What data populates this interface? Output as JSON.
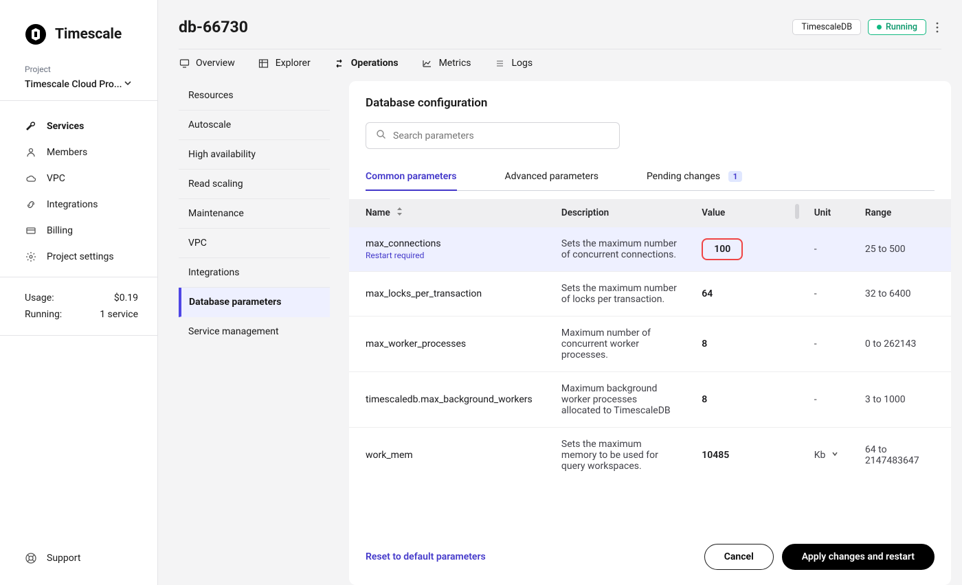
{
  "logo_text": "Timescale",
  "project_label": "Project",
  "project_name": "Timescale Cloud Pro...",
  "nav": {
    "services": "Services",
    "members": "Members",
    "vpc": "VPC",
    "integrations": "Integrations",
    "billing": "Billing",
    "project_settings": "Project settings"
  },
  "usage": {
    "usage_label": "Usage:",
    "usage_value": "$0.19",
    "running_label": "Running:",
    "running_value": "1 service"
  },
  "support_label": "Support",
  "header": {
    "title": "db-66730",
    "badge_db": "TimescaleDB",
    "badge_status": "Running"
  },
  "top_tabs": {
    "overview": "Overview",
    "explorer": "Explorer",
    "operations": "Operations",
    "metrics": "Metrics",
    "logs": "Logs"
  },
  "subnav": {
    "resources": "Resources",
    "autoscale": "Autoscale",
    "ha": "High availability",
    "read_scaling": "Read scaling",
    "maintenance": "Maintenance",
    "vpc": "VPC",
    "integrations": "Integrations",
    "db_params": "Database parameters",
    "service_mgmt": "Service management"
  },
  "panel": {
    "title": "Database configuration",
    "search_placeholder": "Search parameters"
  },
  "param_tabs": {
    "common": "Common parameters",
    "advanced": "Advanced parameters",
    "pending": "Pending changes",
    "pending_count": "1"
  },
  "table": {
    "headers": {
      "name": "Name",
      "description": "Description",
      "value": "Value",
      "unit": "Unit",
      "range": "Range"
    },
    "rows": [
      {
        "name": "max_connections",
        "restart": "Restart required",
        "desc": "Sets the maximum number of concurrent connections.",
        "value": "100",
        "unit": "-",
        "range": "25 to 500",
        "highlight": true
      },
      {
        "name": "max_locks_per_transaction",
        "desc": "Sets the maximum number of locks per transaction.",
        "value": "64",
        "unit": "-",
        "range": "32 to 6400"
      },
      {
        "name": "max_worker_processes",
        "desc": "Maximum number of concurrent worker processes.",
        "value": "8",
        "unit": "-",
        "range": "0 to 262143"
      },
      {
        "name": "timescaledb.max_background_workers",
        "desc": "Maximum background worker processes allocated to TimescaleDB",
        "value": "8",
        "unit": "-",
        "range": "3 to 1000"
      },
      {
        "name": "work_mem",
        "desc": "Sets the maximum memory to be used for query workspaces.",
        "value": "10485",
        "unit": "Kb",
        "unit_dd": true,
        "range": "64 to 2147483647"
      }
    ]
  },
  "footer": {
    "reset": "Reset to default parameters",
    "cancel": "Cancel",
    "apply": "Apply changes and restart"
  }
}
